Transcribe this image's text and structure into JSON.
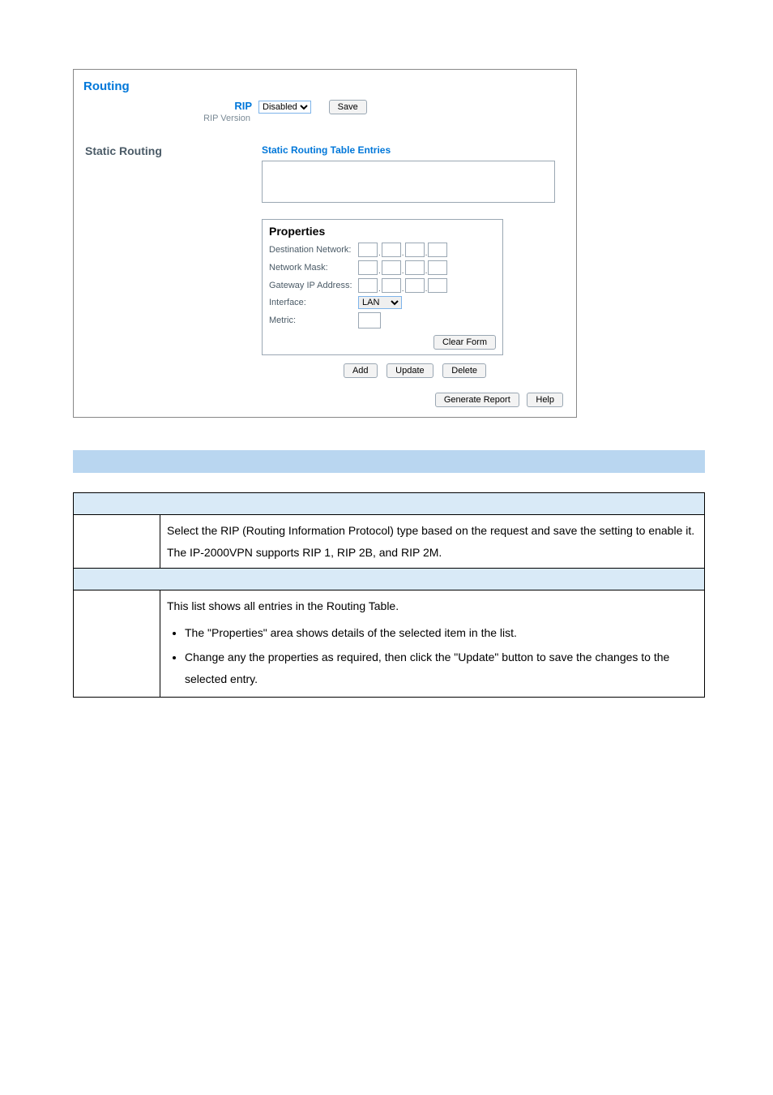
{
  "panel": {
    "title": "Routing",
    "rip": {
      "label": "RIP",
      "sublabel": "RIP Version",
      "select_value": "Disabled",
      "save_btn": "Save"
    },
    "static": {
      "header": "Static Routing",
      "entries_title": "Static Routing Table Entries"
    },
    "props": {
      "title": "Properties",
      "dest": "Destination Network:",
      "mask": "Network Mask:",
      "gw": "Gateway IP Address:",
      "iface": "Interface:",
      "iface_value": "LAN",
      "metric": "Metric:",
      "clear_btn": "Clear Form"
    },
    "buttons": {
      "add": "Add",
      "update": "Update",
      "delete": "Delete",
      "generate": "Generate Report",
      "help": "Help"
    }
  },
  "table": {
    "rip_desc1": "Select the RIP (Routing Information Protocol) type based on the request and save the setting to enable it.",
    "rip_desc2": "The IP-2000VPN supports RIP 1, RIP 2B, and RIP 2M.",
    "sr_line1": "This list shows all entries in the Routing Table.",
    "sr_b1": "The \"Properties\" area shows details of the selected item in the list.",
    "sr_b2": "Change any the properties as required, then click the \"Update\" button to save the changes to the selected entry."
  }
}
